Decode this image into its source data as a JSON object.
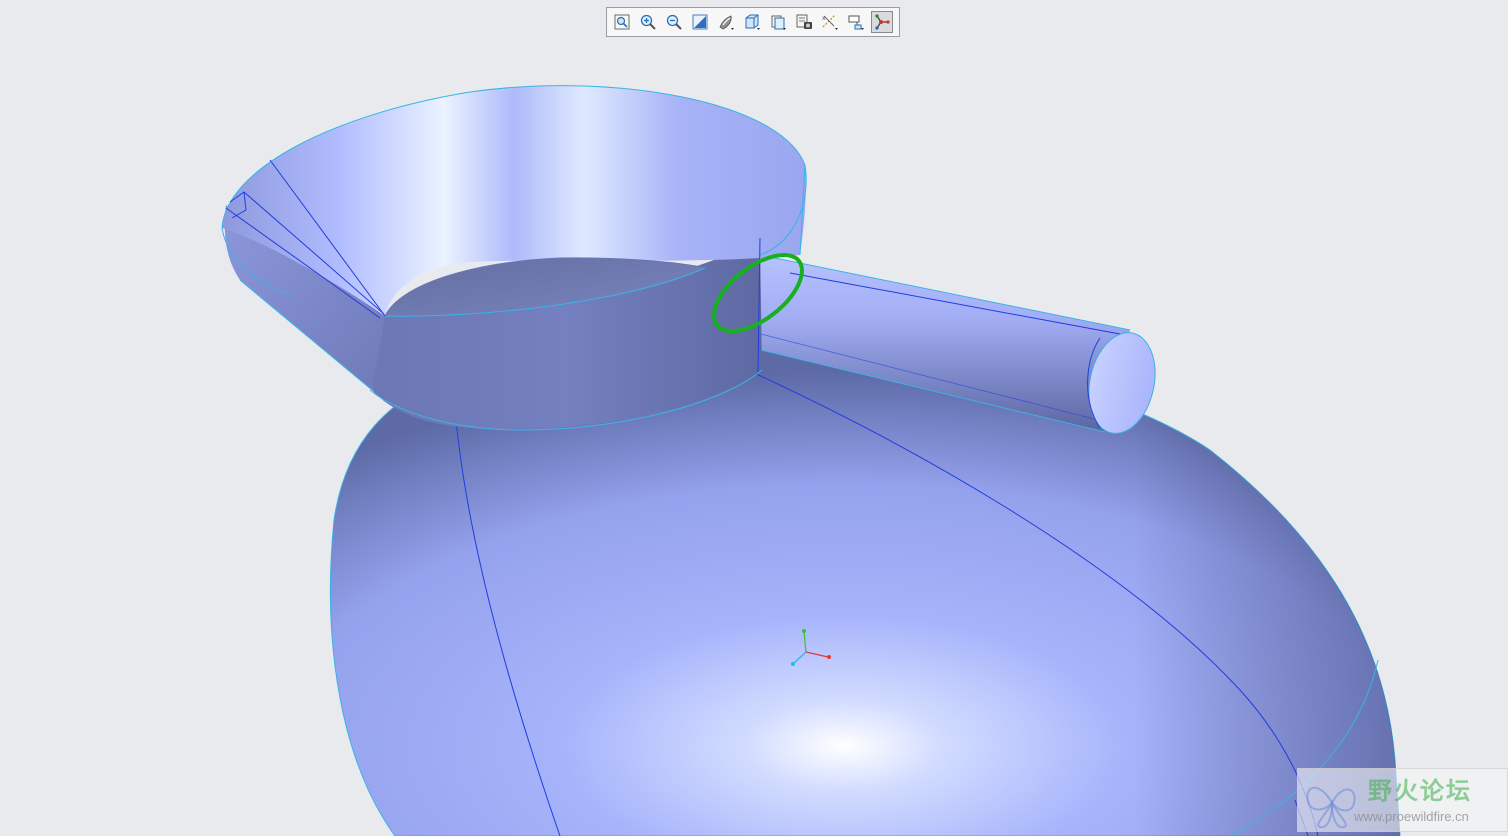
{
  "toolbar": {
    "buttons": [
      {
        "name": "refit-icon",
        "label": "Refit"
      },
      {
        "name": "zoom-in-icon",
        "label": "Zoom In"
      },
      {
        "name": "zoom-out-icon",
        "label": "Zoom Out"
      },
      {
        "name": "repaint-icon",
        "label": "Repaint"
      },
      {
        "name": "display-style-icon",
        "label": "Display Style"
      },
      {
        "name": "saved-orientations-icon",
        "label": "Saved Orientations"
      },
      {
        "name": "view-manager-icon",
        "label": "View Manager"
      },
      {
        "name": "perspective-view-icon",
        "label": "Perspective View"
      },
      {
        "name": "datum-display-filters-icon",
        "label": "Datum Display Filters"
      },
      {
        "name": "annotation-display-icon",
        "label": "Annotation Display"
      },
      {
        "name": "spin-center-icon",
        "label": "Spin Center",
        "active": true
      }
    ]
  },
  "model": {
    "surface_color": "#a9b4f5",
    "edge_color": "#1f3de0",
    "boundary_color": "#38b6e8",
    "selection_color": "#17b01f"
  },
  "triad": {
    "x_color": "#e53935",
    "y_color": "#3bbf3b",
    "z_color": "#29b6f6"
  },
  "watermark": {
    "title": "野火论坛",
    "url": "www.proewildfire.cn"
  }
}
